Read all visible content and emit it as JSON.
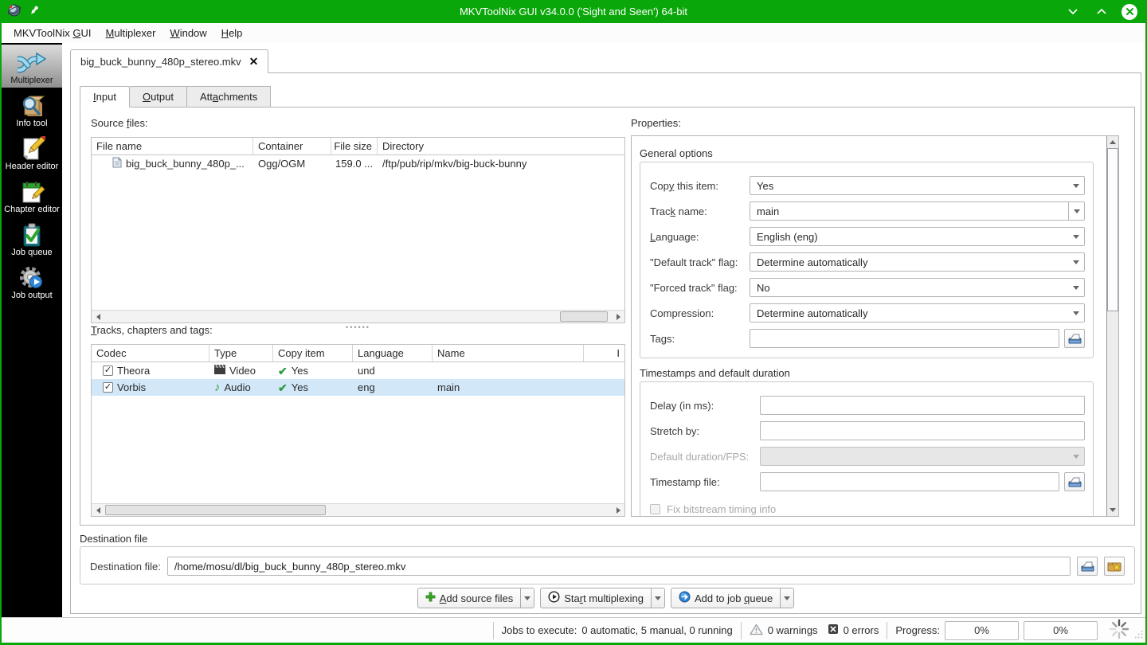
{
  "window": {
    "title": "MKVToolNix GUI v34.0.0 ('Sight and Seen') 64-bit",
    "titlebar_color": "#0aa70a"
  },
  "menubar": {
    "items": [
      {
        "text": "MKVToolNix GUI",
        "key": "G"
      },
      {
        "text": "Multiplexer",
        "key": "M"
      },
      {
        "text": "Window",
        "key": "W"
      },
      {
        "text": "Help",
        "key": "H"
      }
    ]
  },
  "sidebar": {
    "items": [
      {
        "label": "Multiplexer",
        "icon": "multiplexer-icon",
        "selected": true
      },
      {
        "label": "Info tool",
        "icon": "info-tool-icon",
        "selected": false
      },
      {
        "label": "Header editor",
        "icon": "header-editor-icon",
        "selected": false
      },
      {
        "label": "Chapter editor",
        "icon": "chapter-editor-icon",
        "selected": false
      },
      {
        "label": "Job queue",
        "icon": "job-queue-icon",
        "selected": false
      },
      {
        "label": "Job output",
        "icon": "job-output-icon",
        "selected": false
      }
    ]
  },
  "file_tab": {
    "label": "big_buck_bunny_480p_stereo.mkv",
    "close_glyph": "✕"
  },
  "page_tabs": [
    {
      "text": "Input",
      "key": "I"
    },
    {
      "text": "Output",
      "key": "O"
    },
    {
      "text": "Attachments",
      "key": "a"
    }
  ],
  "source_files": {
    "label": {
      "text": "Source files:",
      "key": "f"
    },
    "columns": [
      "File name",
      "Container",
      "File size",
      "Directory"
    ],
    "rows": [
      {
        "file_name": "big_buck_bunny_480p_...",
        "container": "Ogg/OGM",
        "file_size": "159.0 ...",
        "directory": "/ftp/pub/rip/mkv/big-buck-bunny"
      }
    ]
  },
  "tracks": {
    "label": {
      "text": "Tracks, chapters and tags:",
      "key": "T"
    },
    "columns": [
      "Codec",
      "Type",
      "Copy item",
      "Language",
      "Name",
      "I"
    ],
    "rows": [
      {
        "codec": "Theora",
        "type": "Video",
        "type_icon": "video-icon",
        "copy_item": "Yes",
        "language": "und",
        "name": ""
      },
      {
        "codec": "Vorbis",
        "type": "Audio",
        "type_icon": "audio-icon",
        "copy_item": "Yes",
        "language": "eng",
        "name": "main"
      }
    ]
  },
  "properties": {
    "label": "Properties:",
    "general": {
      "title": "General options",
      "copy_this_item": {
        "label": {
          "text": "Copy this item:",
          "key": "y"
        },
        "value": "Yes"
      },
      "track_name": {
        "label": {
          "text": "Track name:",
          "key": "k"
        },
        "value": "main"
      },
      "language": {
        "label": {
          "text": "Language:",
          "key": "L"
        },
        "value": "English (eng)"
      },
      "default_track_flag": {
        "label": "\"Default track\" flag:",
        "value": "Determine automatically"
      },
      "forced_track_flag": {
        "label": "\"Forced track\" flag:",
        "value": "No"
      },
      "compression": {
        "label": "Compression:",
        "value": "Determine automatically"
      },
      "tags": {
        "label": "Tags:",
        "value": ""
      }
    },
    "timestamps": {
      "title": "Timestamps and default duration",
      "delay": {
        "label": "Delay (in ms):",
        "value": ""
      },
      "stretch_by": {
        "label": "Stretch by:",
        "value": ""
      },
      "default_duration": {
        "label": "Default duration/FPS:",
        "value": "",
        "disabled": true
      },
      "timestamp_file": {
        "label": "Timestamp file:",
        "value": ""
      },
      "fix_bitstream": {
        "label": "Fix bitstream timing info",
        "checked": false,
        "disabled": true
      }
    }
  },
  "destination": {
    "section_title": "Destination file",
    "label": "Destination file:",
    "value": "/home/mosu/dl/big_buck_bunny_480p_stereo.mkv"
  },
  "actions": {
    "add_source_files": {
      "text": "Add source files",
      "key": "A",
      "icon": "plus-icon"
    },
    "start_multiplexing": {
      "text": "Start multiplexing",
      "key": "r",
      "icon": "play-icon"
    },
    "add_to_job_queue": {
      "text": "Add to job queue",
      "key": "q",
      "icon": "blue-arrow-icon"
    }
  },
  "status_bar": {
    "jobs_label": "Jobs to execute:",
    "jobs_value": "0 automatic, 5 manual, 0 running",
    "warnings": "0 warnings",
    "errors": "0 errors",
    "progress_label": "Progress:",
    "progress_current": "0%",
    "progress_total": "0%"
  }
}
